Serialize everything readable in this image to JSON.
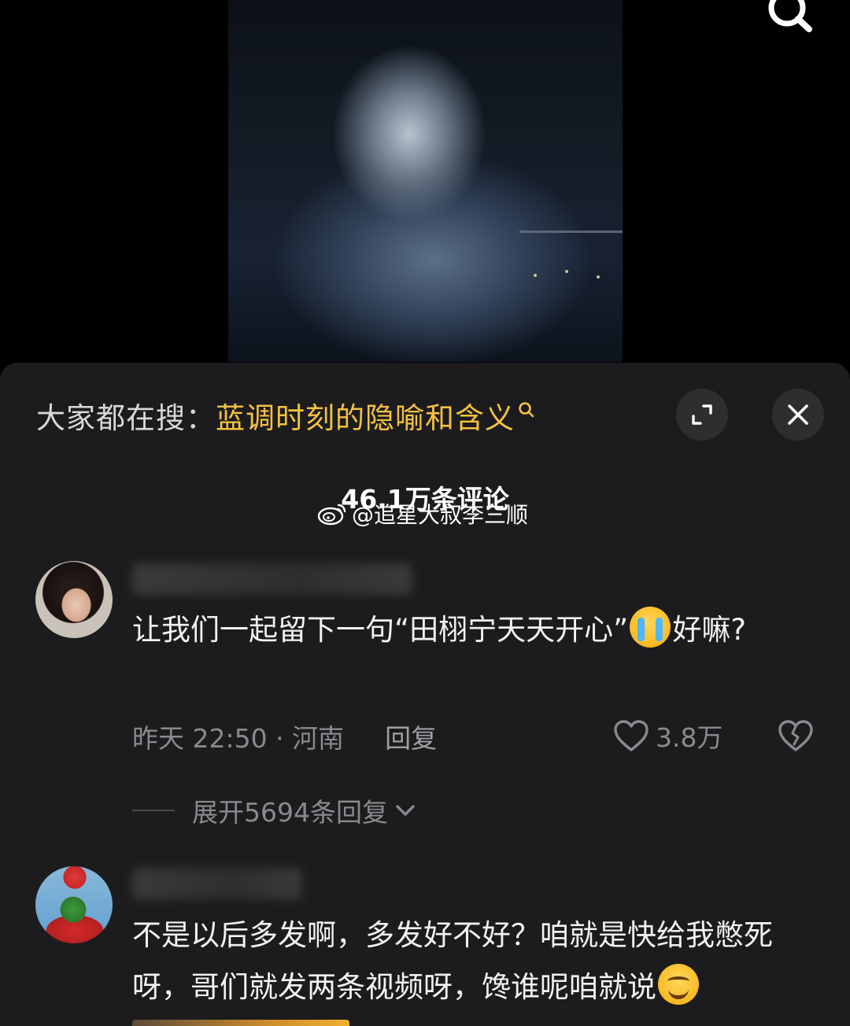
{
  "video": {
    "description_icon": "search-icon"
  },
  "hot_search": {
    "prefix": "大家都在搜：",
    "query": "蓝调时刻的隐喻和含义",
    "query_color": "#f5c242"
  },
  "header": {
    "comment_count": "46.1万条评论",
    "expand_icon": "expand-icon",
    "close_icon": "close-icon"
  },
  "watermark": {
    "text": "@追星大叔李三顺",
    "icon": "weibo-icon"
  },
  "comments": [
    {
      "text_before_emoji": "让我们一起留下一句“田栩宁天天开心”",
      "emoji": "crying-emoji",
      "text_after_emoji": "好嘛?",
      "time_location": "昨天 22:50 · 河南",
      "reply_label": "回复",
      "likes": "3.8万",
      "expand_replies": "展开5694条回复"
    },
    {
      "text": "不是以后多发啊，多发好不好？咱就是快给我憋死呀，哥们就发两条视频呀，馋谁呢咱就说",
      "emoji": "smiling-emoji"
    }
  ]
}
